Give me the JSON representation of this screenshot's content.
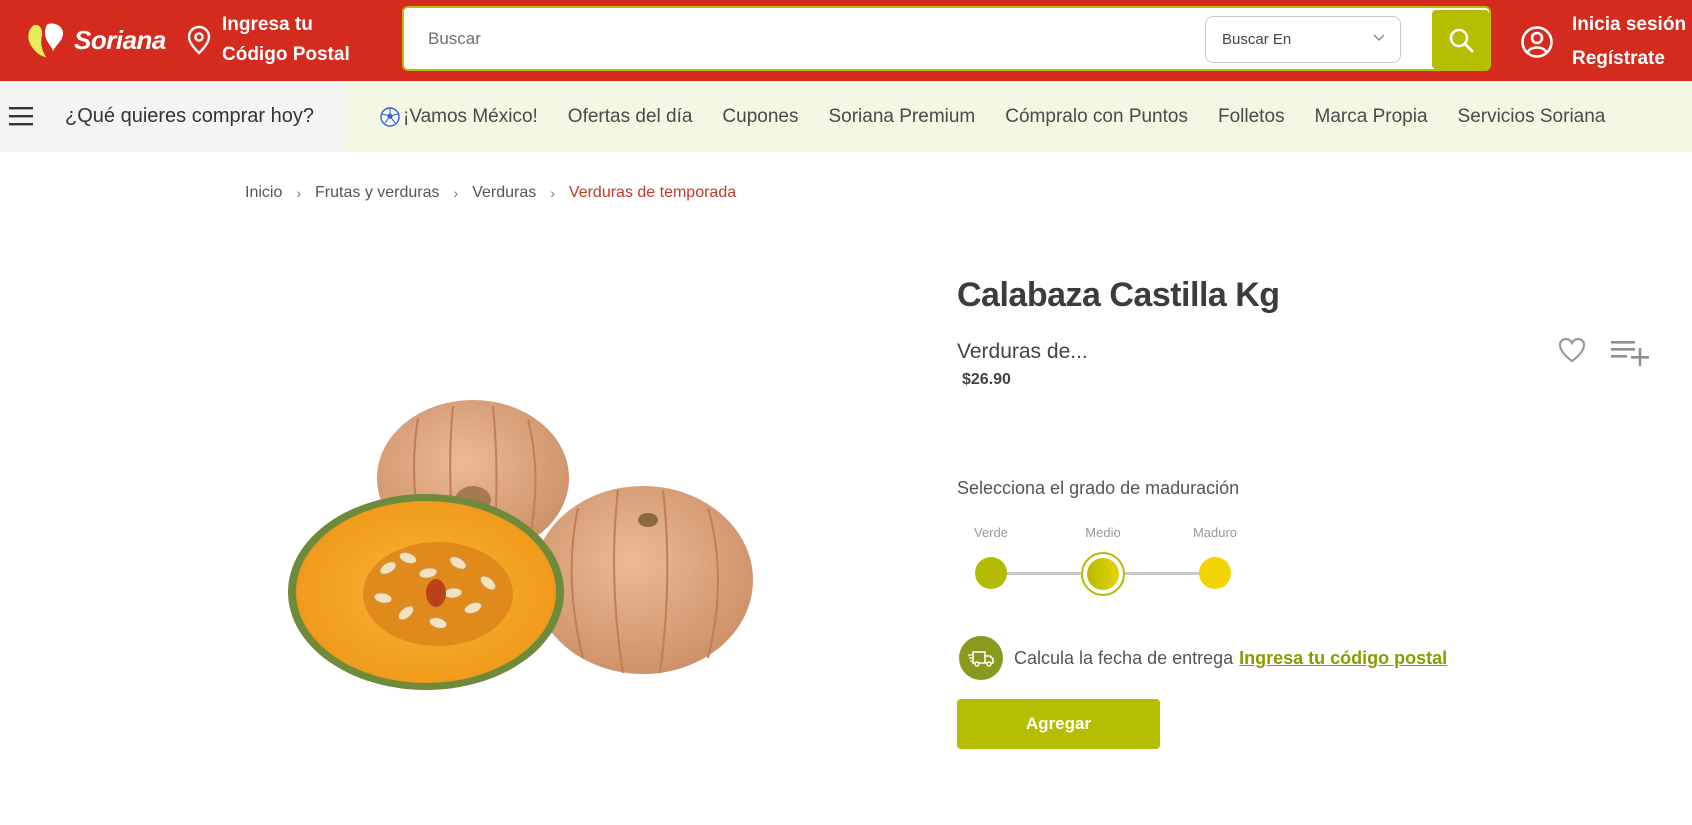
{
  "header": {
    "brand": "Soriana",
    "postal_line1": "Ingresa tu",
    "postal_line2": "Código Postal",
    "search_placeholder": "Buscar",
    "search_scope": "Buscar En",
    "login": "Inicia sesión",
    "register": "Regístrate",
    "brand_color": "#d52b1e",
    "accent_color": "#b5be00"
  },
  "nav": {
    "question": "¿Qué quieres comprar hoy?",
    "items": [
      "¡Vamos México!",
      "Ofertas del día",
      "Cupones",
      "Soriana Premium",
      "Cómpralo con Puntos",
      "Folletos",
      "Marca Propia",
      "Servicios Soriana"
    ]
  },
  "breadcrumb": {
    "items": [
      "Inicio",
      "Frutas y verduras",
      "Verduras"
    ],
    "current": "Verduras de temporada",
    "separator": "›"
  },
  "product": {
    "title": "Calabaza Castilla Kg",
    "category": "Verduras de...",
    "price": "$26.90",
    "image_alt": "Calabaza castilla"
  },
  "ripeness": {
    "label": "Selecciona el grado de maduración",
    "options": [
      "Verde",
      "Medio",
      "Maduro"
    ],
    "selected": "Medio"
  },
  "delivery": {
    "text": "Calcula la fecha de entrega",
    "link": "Ingresa tu código postal"
  },
  "actions": {
    "add": "Agregar"
  }
}
